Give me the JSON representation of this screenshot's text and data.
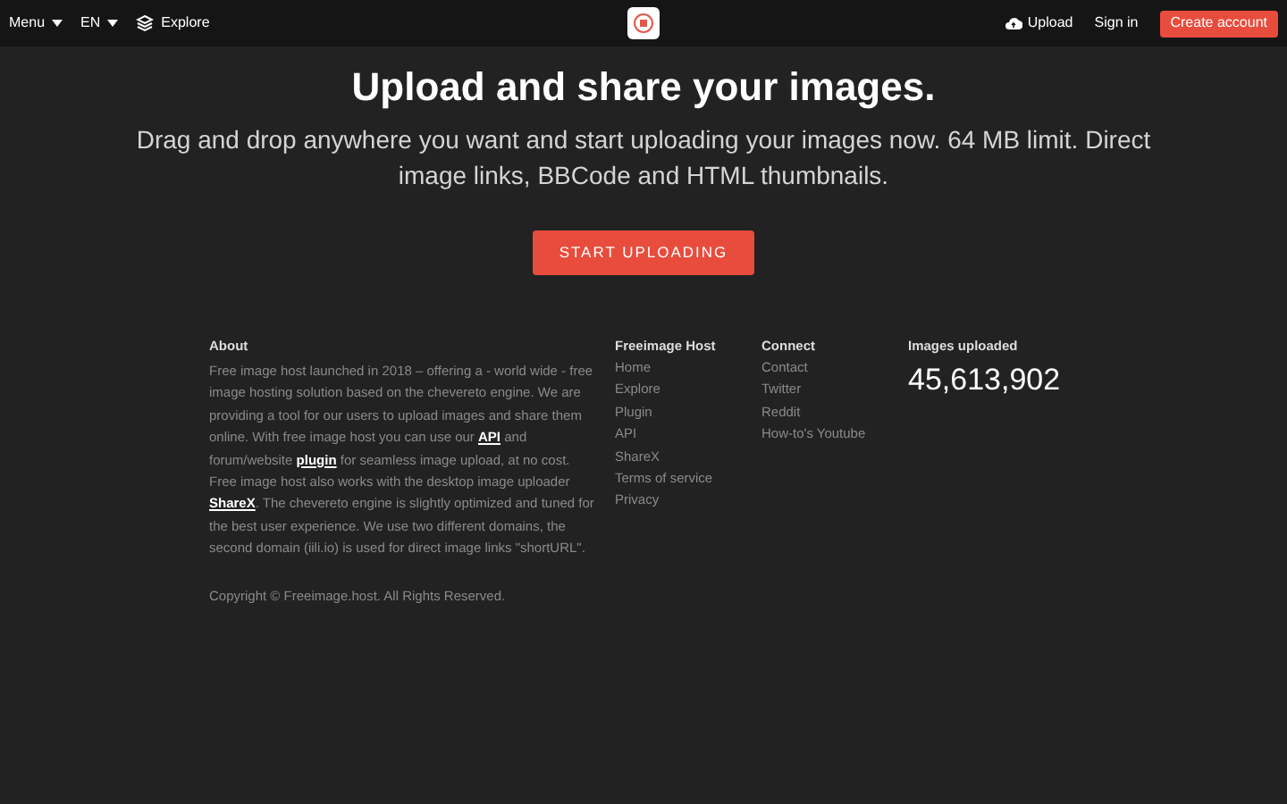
{
  "header": {
    "menu": "Menu",
    "language": "EN",
    "explore": "Explore",
    "upload": "Upload",
    "sign_in": "Sign in",
    "create_account": "Create account"
  },
  "hero": {
    "title": "Upload and share your images.",
    "subtitle": "Drag and drop anywhere you want and start uploading your images now. 64 MB limit. Direct image links, BBCode and HTML thumbnails.",
    "button": "START UPLOADING"
  },
  "about": {
    "heading": "About",
    "segments": [
      {
        "kind": "text",
        "text": "Free image host launched in 2018 – offering a - world wide - free image hosting solution based on the chevereto engine. We are providing a tool for our users to upload images and share them online. With free image host you can use our "
      },
      {
        "kind": "link",
        "text": "API"
      },
      {
        "kind": "text",
        "text": " and forum/website "
      },
      {
        "kind": "link",
        "text": "plugin"
      },
      {
        "kind": "text",
        "text": " for seamless image upload, at no cost. Free image host also works with the desktop image uploader "
      },
      {
        "kind": "link",
        "text": "ShareX"
      },
      {
        "kind": "text",
        "text": ". The chevereto engine is slightly optimized and tuned for the best user experience. We use two different domains, the second domain (iili.io) is used for direct image links \"shortURL\"."
      }
    ],
    "copyright": "Copyright © Freeimage.host. All Rights Reserved."
  },
  "columns": [
    {
      "heading": "Freeimage Host",
      "links": [
        "Home",
        "Explore",
        "Plugin",
        "API",
        "ShareX",
        "Terms of service",
        "Privacy"
      ]
    },
    {
      "heading": "Connect",
      "links": [
        "Contact",
        "Twitter",
        "Reddit",
        "How-to's Youtube"
      ]
    }
  ],
  "stats": {
    "heading": "Images uploaded",
    "value": "45,613,902"
  }
}
